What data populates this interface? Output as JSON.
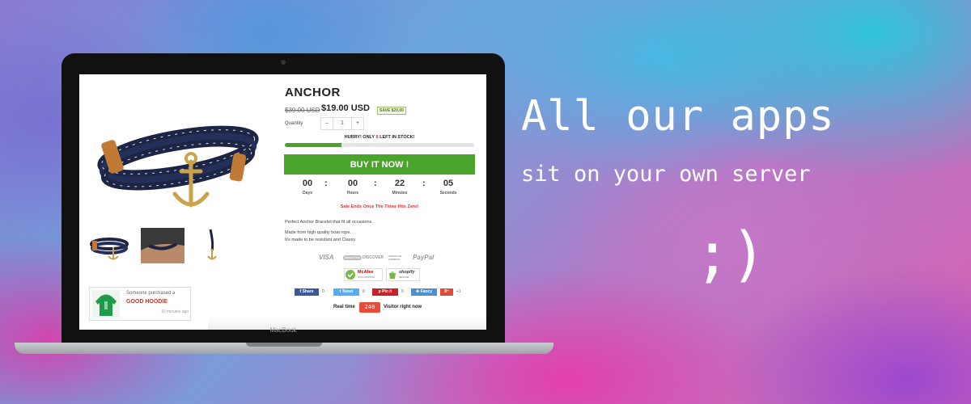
{
  "headline": "All our apps",
  "subheadline": "sit on your own server",
  "smiley": ";)",
  "laptop_brand": "MacBook",
  "product": {
    "title": "ANCHOR",
    "old_price": "$39.00 USD",
    "price": "$19.00 USD",
    "save_badge": "SAVE $20.00",
    "quantity_label": "Quantity",
    "quantity_minus": "–",
    "quantity_value": "1",
    "quantity_plus": "+",
    "stock_pre": "HURRY! ONLY ",
    "stock_count": "8",
    "stock_post": " LEFT IN STOCK!",
    "stock_fraction": 0.3,
    "buy_label": "BUY IT NOW !",
    "timer": [
      {
        "value": "00",
        "label": "Days"
      },
      {
        "value": "00",
        "label": "Hours"
      },
      {
        "value": "22",
        "label": "Minutes"
      },
      {
        "value": "05",
        "label": "Seconds"
      }
    ],
    "timer_sep": ":",
    "sale_ends": "Sale Ends Once The Timer Hits Zero!",
    "desc1": "Perfect Anchor Bracelet that fit all occasions.",
    "desc2": "Made from high quality boat rope.",
    "desc3": "It's made to be resistant and Classy."
  },
  "payments": [
    "VISA",
    "MasterCard",
    "DISCOVER",
    "AMERICAN EXPRESS",
    "PayPal"
  ],
  "trust_badges": [
    {
      "name": "McAfee",
      "sub": "SITE ADVISOR"
    },
    {
      "name": "shopify",
      "sub": "SECURE"
    }
  ],
  "share_buttons": [
    {
      "label": "Share",
      "count": "0",
      "color": "#3b5998"
    },
    {
      "label": "Tweet",
      "count": "0",
      "color": "#55acee"
    },
    {
      "label": "Pin it",
      "count": "0",
      "color": "#cb2027"
    },
    {
      "label": "Fancy",
      "count": "0",
      "color": "#4b8fd6"
    },
    {
      "label": "8⁺",
      "count": "+1",
      "color": "#dd4b39"
    }
  ],
  "realtime": {
    "prefix": "Real time",
    "count": "240",
    "suffix": "Visitor right now"
  },
  "sales_popup": {
    "line1": "Someone purchased a",
    "product": "GOOD HOODIE",
    "time": "10 minutes ago"
  }
}
